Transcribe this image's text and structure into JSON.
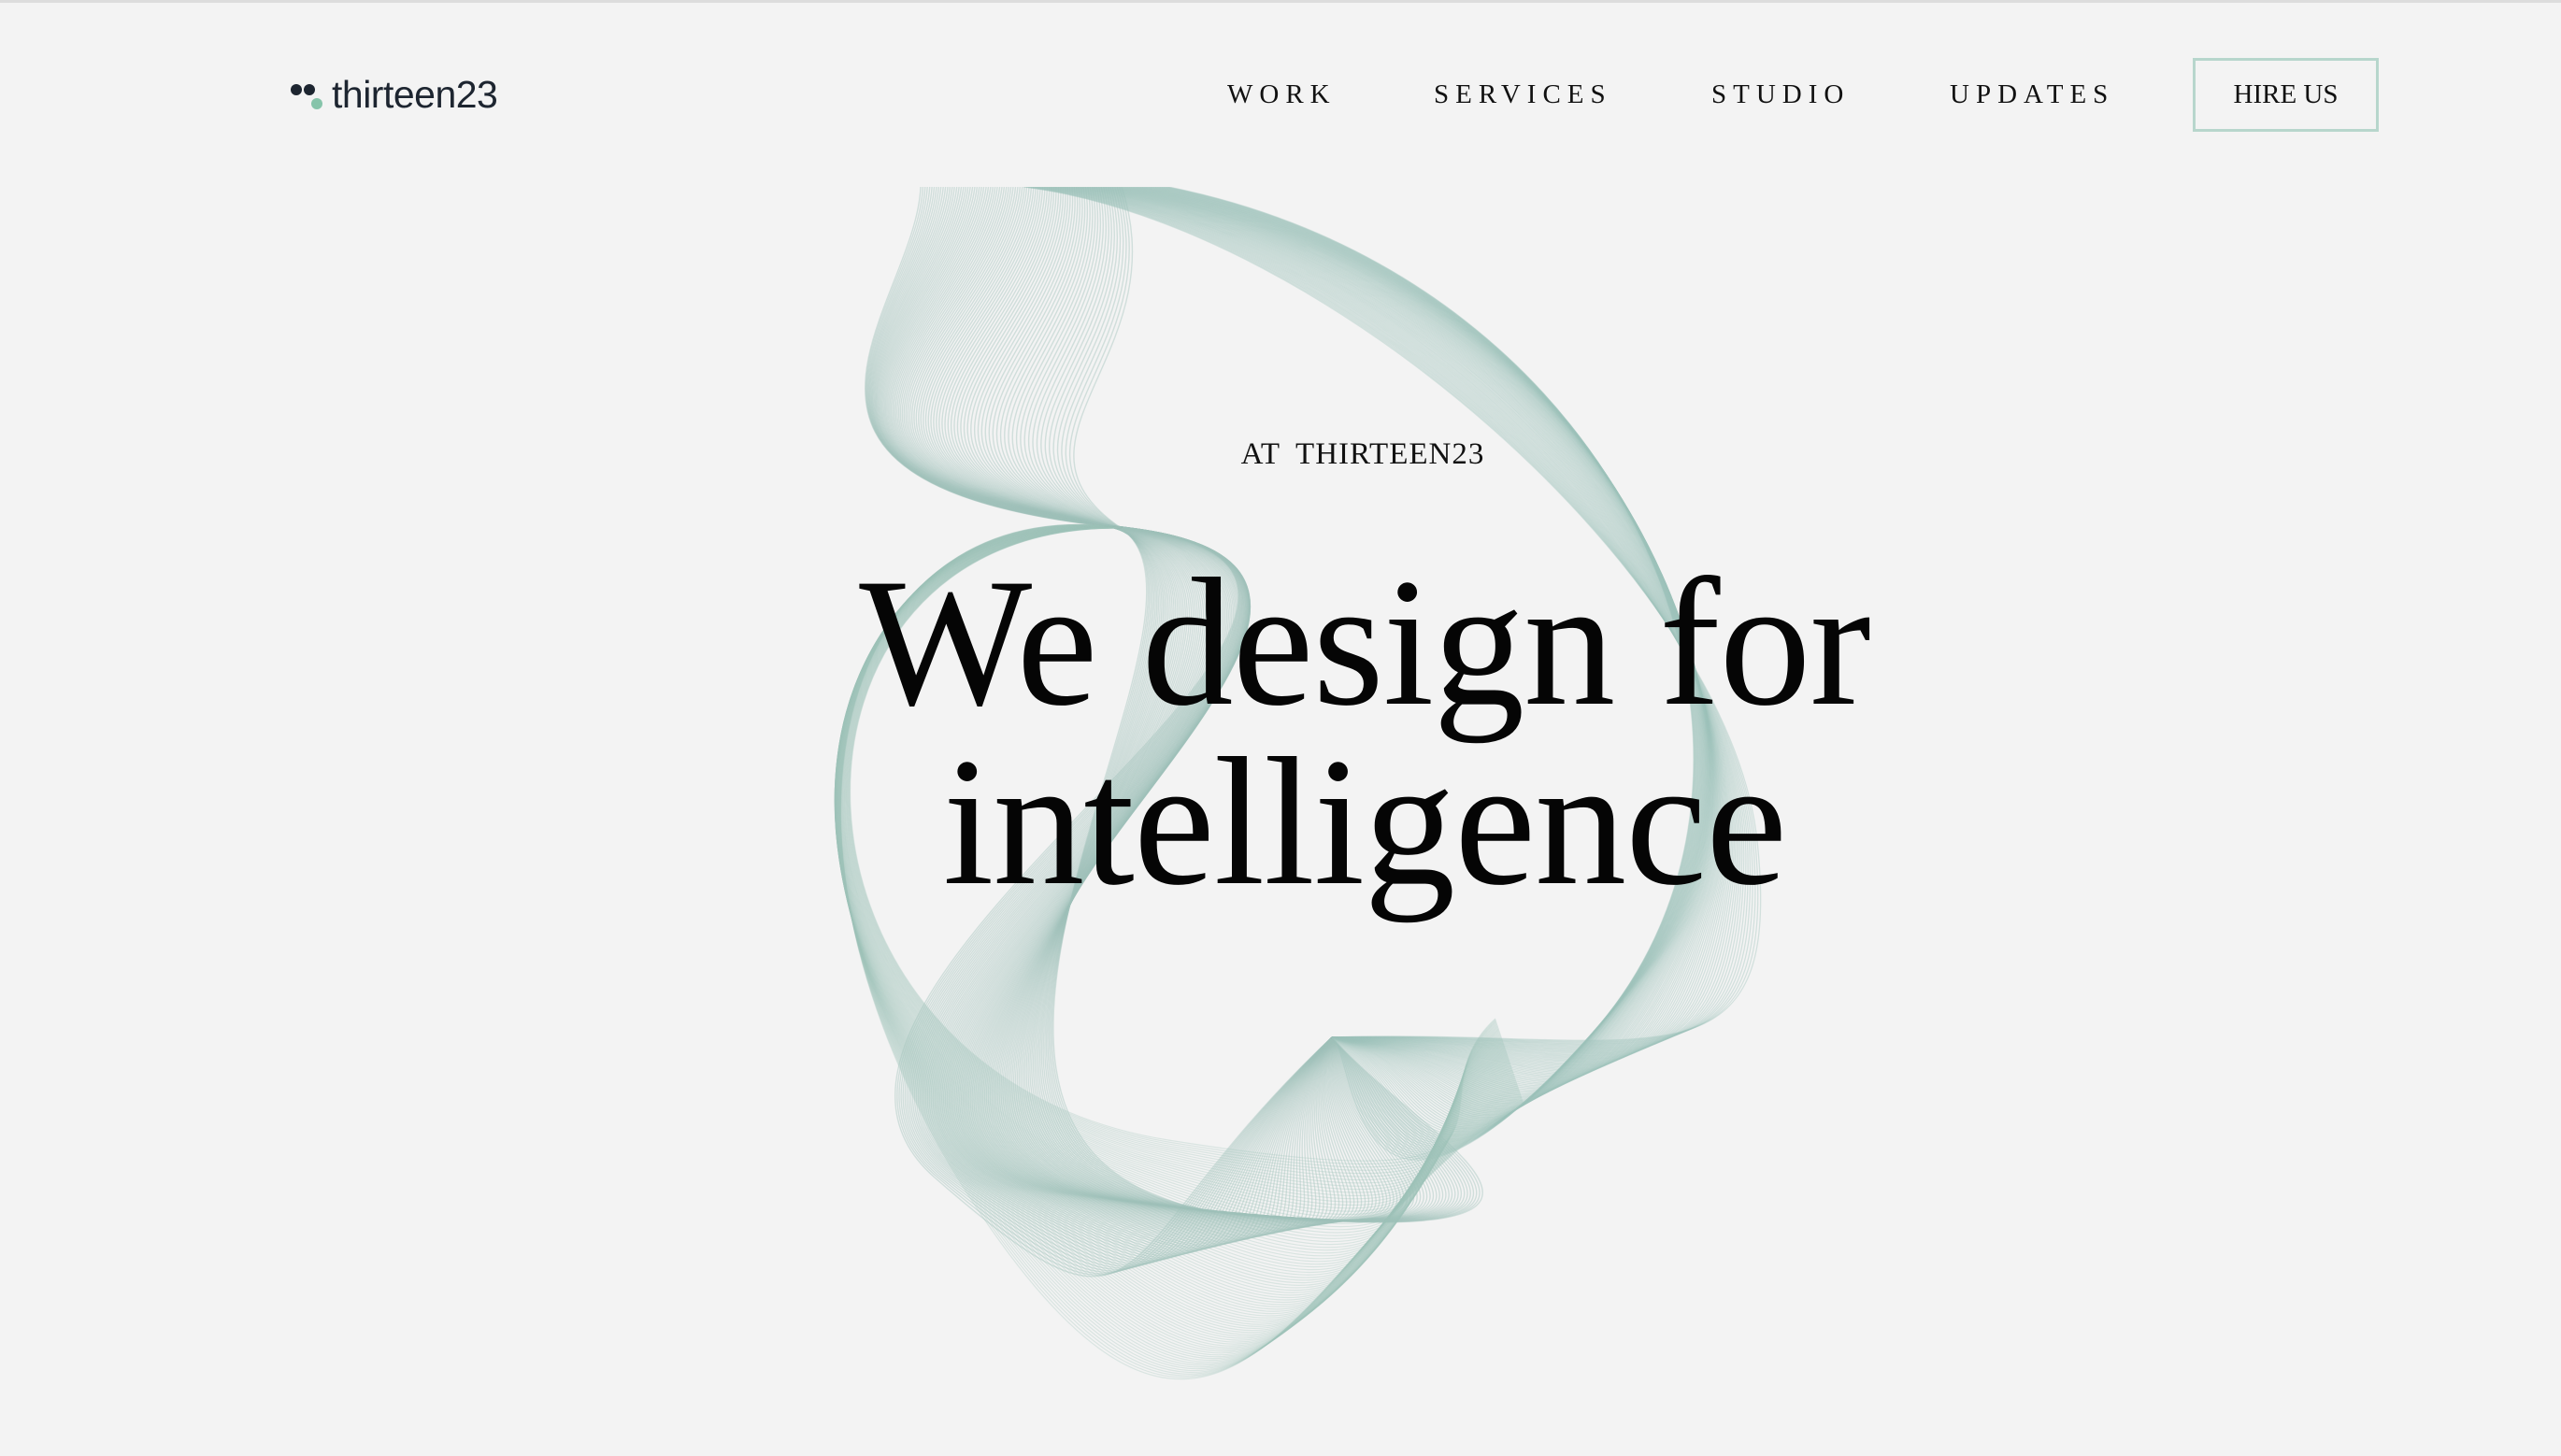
{
  "brand": {
    "name": "thirteen23",
    "icon": "three-dots-logo-icon",
    "colors": {
      "dark": "#1d2530",
      "accent": "#86c4aa"
    }
  },
  "nav": {
    "items": [
      {
        "label": "WORK"
      },
      {
        "label": "SERVICES"
      },
      {
        "label": "STUDIO"
      },
      {
        "label": "UPDATES"
      }
    ],
    "cta_label": "HIRE US",
    "cta_border_color": "#b7d6cc"
  },
  "hero": {
    "eyebrow": "AT THIRTEEN23",
    "headline_line1": "We design for",
    "headline_line2": "intelligence",
    "art": "line-mesh-ribbon",
    "art_color": "#9fc2ba"
  },
  "page": {
    "background": "#f3f3f3"
  }
}
